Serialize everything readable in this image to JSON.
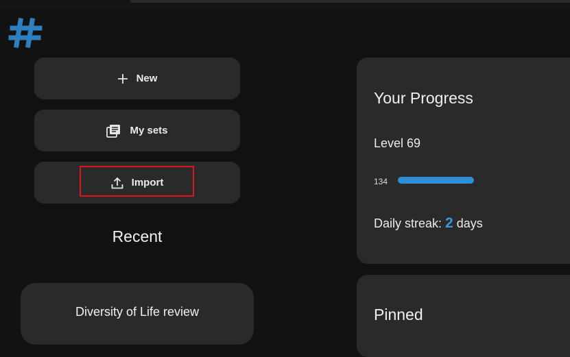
{
  "actions": {
    "new_label": "New",
    "mysets_label": "My sets",
    "import_label": "Import"
  },
  "recent": {
    "heading": "Recent",
    "items": [
      {
        "title": "Diversity of Life review"
      }
    ]
  },
  "progress": {
    "heading": "Your Progress",
    "level_label": "Level 69",
    "xp": "134",
    "xp_fill_fraction": 1.0,
    "streak_prefix": "Daily streak: ",
    "streak_days": "2",
    "streak_suffix": " days"
  },
  "pinned": {
    "heading": "Pinned"
  },
  "colors": {
    "accent": "#2f8fd6",
    "highlight": "#e0141a",
    "card": "#2a2a2a",
    "background": "#121212"
  },
  "icons": {
    "logo": "hashtag-logo",
    "new": "plus-icon",
    "mysets": "stack-of-cards-icon",
    "import": "upload-icon"
  }
}
